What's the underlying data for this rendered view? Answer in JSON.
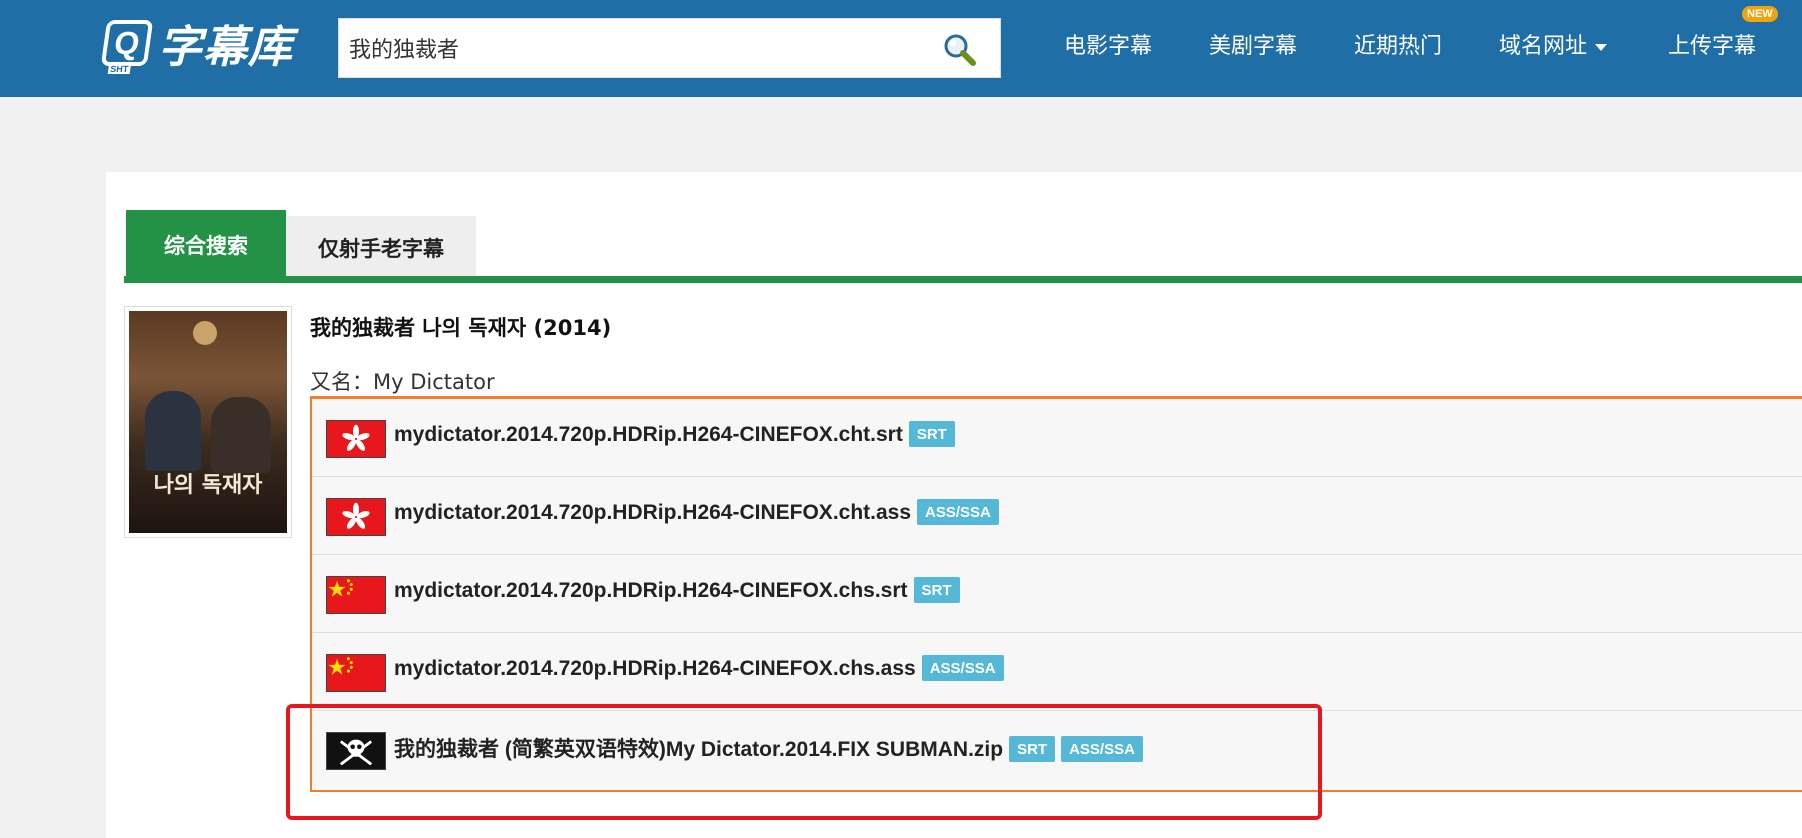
{
  "header": {
    "logo": {
      "icon_letter": "Q",
      "icon_sub": "SHT",
      "text": "字幕库"
    },
    "search": {
      "value": "我的独裁者",
      "placeholder": ""
    },
    "nav": [
      {
        "label": "电影字幕"
      },
      {
        "label": "美剧字幕"
      },
      {
        "label": "近期热门"
      },
      {
        "label": "域名网址"
      },
      {
        "label": "上传字幕"
      }
    ],
    "new_badge": "NEW"
  },
  "tabs": [
    {
      "label": "综合搜索",
      "active": true
    },
    {
      "label": "仅射手老字幕",
      "active": false
    }
  ],
  "movie": {
    "title": "我的独裁者 나의 독재자 (2014)",
    "alias": "又名：My Dictator",
    "poster_text": "나의 독재자"
  },
  "files": [
    {
      "flag": "hk",
      "name": "mydictator.2014.720p.HDRip.H264-CINEFOX.cht.srt",
      "badges": [
        "SRT"
      ]
    },
    {
      "flag": "hk",
      "name": "mydictator.2014.720p.HDRip.H264-CINEFOX.cht.ass",
      "badges": [
        "ASS/SSA"
      ]
    },
    {
      "flag": "cn",
      "name": "mydictator.2014.720p.HDRip.H264-CINEFOX.chs.srt",
      "badges": [
        "SRT"
      ]
    },
    {
      "flag": "cn",
      "name": "mydictator.2014.720p.HDRip.H264-CINEFOX.chs.ass",
      "badges": [
        "ASS/SSA"
      ]
    },
    {
      "flag": "pirate",
      "name": "我的独裁者 (简繁英双语特效)My Dictator.2014.FIX SUBMAN.zip",
      "badges": [
        "SRT",
        "ASS/SSA"
      ]
    }
  ],
  "colors": {
    "header_bg": "#1f6fa6",
    "tab_active": "#239247",
    "list_border": "#f57c2a",
    "badge": "#55b8d6",
    "highlight": "#e8171b"
  },
  "icons": {
    "search": "magnifier-icon",
    "dropdown": "caret-down-icon",
    "hk_flag": "hong-kong-flag-icon",
    "cn_flag": "china-flag-icon",
    "pirate_flag": "jolly-roger-icon"
  }
}
